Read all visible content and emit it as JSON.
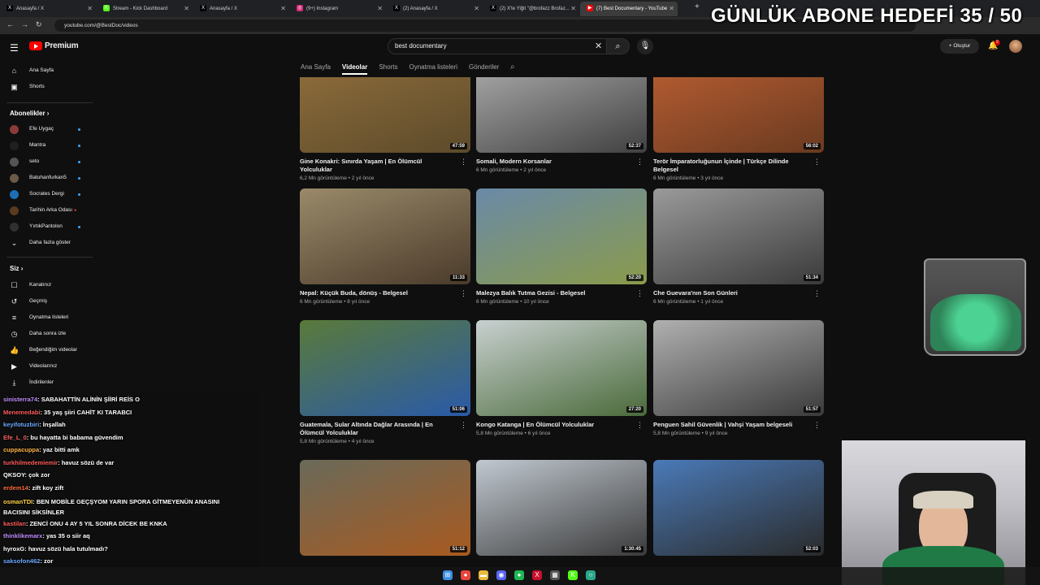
{
  "browser": {
    "tabs": [
      {
        "title": "Anasayfa / X",
        "icon": "X"
      },
      {
        "title": "Stream - Kick Dashboard",
        "icon": "K"
      },
      {
        "title": "Anasayfa / X",
        "icon": "X"
      },
      {
        "title": "(9+) Instagram",
        "icon": "◎"
      },
      {
        "title": "(2) Anasayfa / X",
        "icon": "X"
      },
      {
        "title": "(2) X'te Yiğit \"@brofazz Brofaz...",
        "icon": "X"
      },
      {
        "title": "(7) Best Documentary - YouTube",
        "icon": "▶"
      }
    ],
    "url": "youtube.com/@BestDoc/videos"
  },
  "overlay": {
    "goal_text": "GÜNLÜK ABONE HEDEFİ 35 / 50"
  },
  "youtube": {
    "logo_text": "Premium",
    "search_value": "best documentary",
    "create_label": "Oluştur",
    "notification_count": "9",
    "channel_tabs": [
      "Ana Sayfa",
      "Videolar",
      "Shorts",
      "Oynatma listeleri",
      "Gönderiler"
    ],
    "active_tab": "Videolar"
  },
  "sidebar": {
    "top": [
      {
        "label": "Ana Sayfa",
        "icon": "home-icon"
      },
      {
        "label": "Shorts",
        "icon": "shorts-icon"
      }
    ],
    "subs_header": "Abonelikler",
    "subs": [
      {
        "label": "Efe Uygaç",
        "live": false,
        "color": "#8b3a3a"
      },
      {
        "label": "Mantra",
        "live": false,
        "color": "#202020"
      },
      {
        "label": "seto",
        "live": false,
        "color": "#555555"
      },
      {
        "label": "Batuhanfurkan5",
        "live": false,
        "color": "#6b5a48"
      },
      {
        "label": "Socrates Dergi",
        "live": false,
        "color": "#1c6fb5"
      },
      {
        "label": "Tarihin Arka Odası",
        "live": true,
        "color": "#5a3a20"
      },
      {
        "label": "YırtıkPantolon",
        "live": false,
        "color": "#303030"
      }
    ],
    "show_more": "Daha fazla göster",
    "you_header": "Siz",
    "you": [
      {
        "label": "Kanalınız",
        "icon": "account-icon"
      },
      {
        "label": "Geçmiş",
        "icon": "history-icon"
      },
      {
        "label": "Oynatma listeleri",
        "icon": "playlist-icon"
      },
      {
        "label": "Daha sonra izle",
        "icon": "clock-icon"
      },
      {
        "label": "Beğendiğim videolar",
        "icon": "like-icon"
      },
      {
        "label": "Videolarınız",
        "icon": "video-icon"
      },
      {
        "label": "İndirilenler",
        "icon": "download-icon"
      }
    ]
  },
  "videos": [
    {
      "title": "Gine Konakri: Sınırda Yaşam | En Ölümcül Yolculuklar",
      "meta": "6,2 Mn görüntüleme • 2 yıl önce",
      "duration": "47:59",
      "colors": [
        "#8a6a3a",
        "#5c4a2a"
      ]
    },
    {
      "title": "Somali, Modern Korsanlar",
      "meta": "6 Mn görüntüleme • 2 yıl önce",
      "duration": "52:37",
      "colors": [
        "#a0a0a0",
        "#404040"
      ]
    },
    {
      "title": "Terör İmparatorluğunun İçinde | Türkçe Dilinde Belgesel",
      "meta": "6 Mn görüntüleme • 3 yıl önce",
      "duration": "56:02",
      "colors": [
        "#b05a30",
        "#6a3a20"
      ]
    },
    {
      "title": "Nepal: Küçük Buda, dönüş - Belgesel",
      "meta": "6 Mn görüntüleme • 8 yıl önce",
      "duration": "11:33",
      "colors": [
        "#9a8a6a",
        "#4a3a2a"
      ]
    },
    {
      "title": "Malezya Balık Tutma Gezisi - Belgesel",
      "meta": "6 Mn görüntüleme • 10 yıl önce",
      "duration": "52:20",
      "colors": [
        "#6a8aa8",
        "#8a9a4a"
      ]
    },
    {
      "title": "Che Guevara'nın Son Günleri",
      "meta": "6 Mn görüntüleme • 1 yıl önce",
      "duration": "51:34",
      "colors": [
        "#9a9a9a",
        "#3a3a3a"
      ]
    },
    {
      "title": "Guatemala, Sular Altında Dağlar Arasında | En Ölümcül Yolculuklar",
      "meta": "5,8 Mn görüntüleme • 4 yıl önce",
      "duration": "51:06",
      "colors": [
        "#5a7a3a",
        "#2a5aa8"
      ]
    },
    {
      "title": "Kongo Katanga | En Ölümcül Yolculuklar",
      "meta": "5,8 Mn görüntüleme • 6 yıl önce",
      "duration": "27:20",
      "colors": [
        "#c8d0d0",
        "#4a6a3a"
      ]
    },
    {
      "title": "Penguen Sahil Güvenlik | Vahşi Yaşam belgeseli",
      "meta": "5,8 Mn görüntüleme • 9 yıl önce",
      "duration": "51:57",
      "colors": [
        "#b0b0b0",
        "#3a3a3a"
      ]
    },
    {
      "title": "",
      "meta": "",
      "duration": "51:12",
      "colors": [
        "#6a6a5a",
        "#a85a20"
      ]
    },
    {
      "title": "",
      "meta": "",
      "duration": "1:30:45",
      "colors": [
        "#c0c8d0",
        "#3a3a3a"
      ]
    },
    {
      "title": "",
      "meta": "",
      "duration": "52:03",
      "colors": [
        "#4a7ab8",
        "#2a2a2a"
      ]
    }
  ],
  "chat": [
    {
      "user": "sinisterra74",
      "msg": ": SABAHATTİN ALİNİN ŞİİRİ REİS O",
      "color": "#c08cff"
    },
    {
      "user": "Menemedabi",
      "msg": ": 35 yaş şiiri CAHİT KI TARABCI",
      "color": "#ff5a5a"
    },
    {
      "user": "keyifotuzbiri",
      "msg": ": İnşallah",
      "color": "#6aa8ff"
    },
    {
      "user": "Efe_L_0",
      "msg": ": bu hayatta bi babama güvendim",
      "color": "#ff6060"
    },
    {
      "user": "cuppacuppa",
      "msg": ": yaz bitti amk",
      "color": "#ffb347"
    },
    {
      "user": "turkhilmedemiemir",
      "msg": ": havuz sözü de var",
      "color": "#ff5a5a"
    },
    {
      "user": "QKSOY",
      "msg": ": çok zor",
      "color": "#ffffff"
    },
    {
      "user": "erdem14",
      "msg": ": zift koy zift",
      "color": "#ff6a3a"
    },
    {
      "user": "osmanTDI",
      "msg": ": BEN MOBİLE GEÇŞYOM YARIN SPORA GİTMEYENÜN ANASINI BACISINI SİKSİNLER",
      "color": "#ffd24a"
    },
    {
      "user": "kastilan",
      "msg": ": ZENCİ ONU 4 AY 5 YIL SONRA DİCEK BE KNKA",
      "color": "#ff5a5a"
    },
    {
      "user": "thinklikemarx",
      "msg": ": yas 35 o siir aq",
      "color": "#c08cff"
    },
    {
      "user": "hyroxG",
      "msg": ": havuz sözü hala tutulmadı?",
      "color": "#ffffff"
    },
    {
      "user": "saksofon462",
      "msg": ": zor",
      "color": "#6aa8ff"
    }
  ],
  "taskbar": [
    {
      "name": "windows-start-icon",
      "color": "#3a8ee6",
      "glyph": "⊞"
    },
    {
      "name": "chrome-icon",
      "color": "#e8453c",
      "glyph": "●"
    },
    {
      "name": "folder-icon",
      "color": "#e8b93c",
      "glyph": "▬"
    },
    {
      "name": "discord-icon",
      "color": "#5865f2",
      "glyph": "◉"
    },
    {
      "name": "spotify-icon",
      "color": "#1db954",
      "glyph": "●"
    },
    {
      "name": "x-app-icon",
      "color": "#c8102e",
      "glyph": "X"
    },
    {
      "name": "calculator-icon",
      "color": "#555555",
      "glyph": "▦"
    },
    {
      "name": "kick-icon",
      "color": "#53fc18",
      "glyph": "K"
    },
    {
      "name": "app-icon",
      "color": "#2aa88a",
      "glyph": "○"
    }
  ]
}
